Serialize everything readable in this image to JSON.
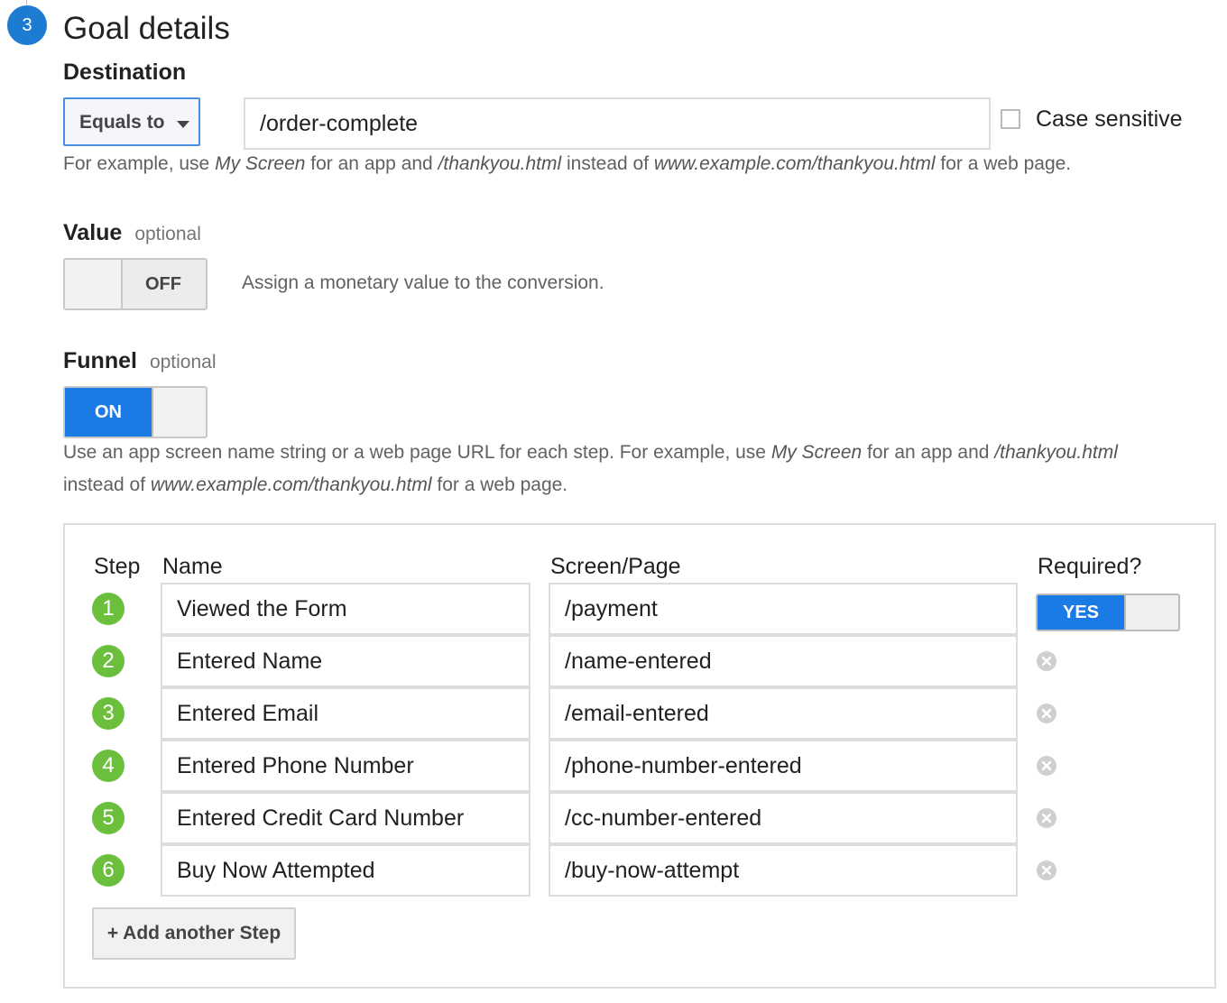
{
  "section": {
    "number": "3",
    "title": "Goal details"
  },
  "destination": {
    "label": "Destination",
    "match_type": "Equals to",
    "value": "/order-complete",
    "case_sensitive_label": "Case sensitive",
    "case_sensitive_checked": false,
    "help": {
      "p1": "For example, use ",
      "e1": "My Screen",
      "p2": " for an app and ",
      "e2": "/thankyou.html",
      "p3": " instead of ",
      "e3": "www.example.com/thankyou.html",
      "p4": " for a web page."
    }
  },
  "value": {
    "label": "Value",
    "optional": "optional",
    "toggle_text": "OFF",
    "toggle_state": "off",
    "help": "Assign a monetary value to the conversion."
  },
  "funnel": {
    "label": "Funnel",
    "optional": "optional",
    "toggle_text": "ON",
    "toggle_state": "on",
    "help": {
      "p1": "Use an app screen name string or a web page URL for each step. For example, use ",
      "e1": "My Screen",
      "p2": " for an app and ",
      "e2": "/thankyou.html",
      "p3": "instead of ",
      "e3": "www.example.com/thankyou.html",
      "p4": " for a web page."
    },
    "columns": {
      "step": "Step",
      "name": "Name",
      "page": "Screen/Page",
      "required": "Required?"
    },
    "required_toggle": "YES",
    "steps": [
      {
        "num": "1",
        "name": "Viewed the Form",
        "page": "/payment"
      },
      {
        "num": "2",
        "name": "Entered Name",
        "page": "/name-entered"
      },
      {
        "num": "3",
        "name": "Entered Email",
        "page": "/email-entered"
      },
      {
        "num": "4",
        "name": "Entered Phone Number",
        "page": "/phone-number-entered"
      },
      {
        "num": "5",
        "name": "Entered Credit Card Number",
        "page": "/cc-number-entered"
      },
      {
        "num": "6",
        "name": "Buy Now Attempted",
        "page": "/buy-now-attempt"
      }
    ],
    "add_step_label": "+ Add another Step"
  },
  "colors": {
    "accent_blue": "#1a7ae6",
    "step_green": "#6cbf3c",
    "section_blue": "#1e7bd2"
  }
}
